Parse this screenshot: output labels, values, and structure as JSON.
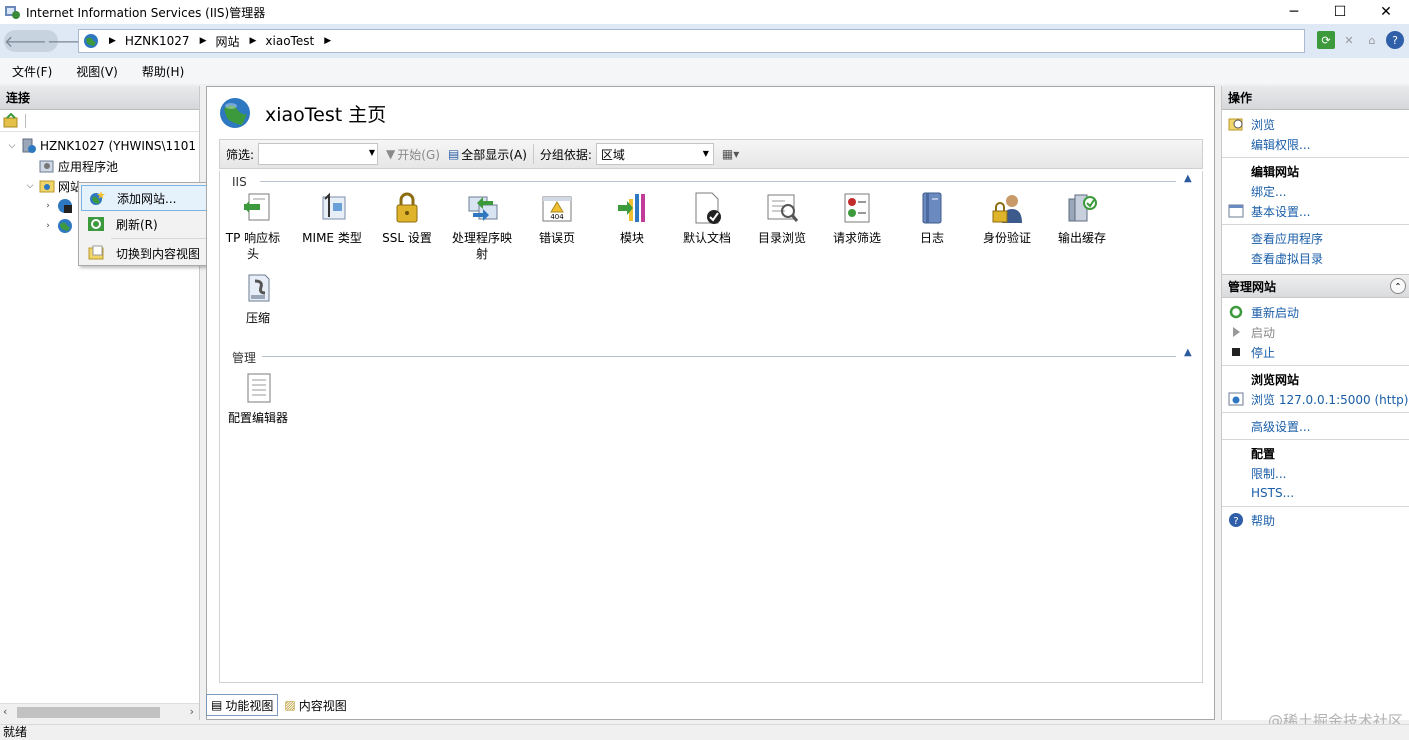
{
  "window": {
    "title": "Internet Information Services (IIS)管理器",
    "controls": [
      "minimize",
      "maximize",
      "close"
    ]
  },
  "address": {
    "crumbs": [
      "HZNK1027",
      "网站",
      "xiaoTest"
    ]
  },
  "menu": [
    "文件(F)",
    "视图(V)",
    "帮助(H)"
  ],
  "left": {
    "header": "连接",
    "tree": [
      {
        "label": "HZNK1027 (YHWINS\\1101",
        "expanded": true
      },
      {
        "label": "应用程序池"
      },
      {
        "label": "网站",
        "expanded": true
      }
    ]
  },
  "context_menu": {
    "items": [
      "添加网站...",
      "刷新(R)",
      "切换到内容视图"
    ],
    "selected": "添加网站..."
  },
  "center": {
    "title": "xiaoTest 主页",
    "filter": {
      "label": "筛选:",
      "go": "开始(G)",
      "show_all": "全部显示(A)",
      "group_label": "分组依据:",
      "group_value": "区域"
    },
    "sections": {
      "iis": "IIS",
      "manage": "管理"
    },
    "iis_features": [
      {
        "label": "TP 响应标\n头",
        "icon": "http-headers-icon"
      },
      {
        "label": "MIME 类型",
        "icon": "mime-icon"
      },
      {
        "label": "SSL 设置",
        "icon": "lock-icon"
      },
      {
        "label": "处理程序映\n射",
        "icon": "handler-mappings-icon"
      },
      {
        "label": "错误页",
        "icon": "error-page-icon"
      },
      {
        "label": "模块",
        "icon": "modules-icon"
      },
      {
        "label": "默认文档",
        "icon": "default-document-icon"
      },
      {
        "label": "目录浏览",
        "icon": "directory-browsing-icon"
      },
      {
        "label": "请求筛选",
        "icon": "request-filtering-icon"
      },
      {
        "label": "日志",
        "icon": "logging-icon"
      },
      {
        "label": "身份验证",
        "icon": "authentication-icon"
      },
      {
        "label": "输出缓存",
        "icon": "output-caching-icon"
      },
      {
        "label": "压缩",
        "icon": "compression-icon"
      }
    ],
    "manage_features": [
      {
        "label": "配置编辑器",
        "icon": "configuration-editor-icon"
      }
    ],
    "tabs": [
      "功能视图",
      "内容视图"
    ],
    "active_tab": "功能视图"
  },
  "actions": {
    "header": "操作",
    "explore": "浏览",
    "edit_permissions": "编辑权限...",
    "edit_site_header": "编辑网站",
    "bindings": "绑定...",
    "basic_settings": "基本设置...",
    "view_apps": "查看应用程序",
    "view_vdirs": "查看虚拟目录",
    "manage_site_header": "管理网站",
    "restart": "重新启动",
    "start": "启动",
    "stop": "停止",
    "browse_site_header": "浏览网站",
    "browse_link": "浏览 127.0.0.1:5000 (http)",
    "advanced_settings": "高级设置...",
    "configure_header": "配置",
    "limits": "限制...",
    "hsts": "HSTS...",
    "help": "帮助"
  },
  "status": "就绪",
  "watermark": "@稀土掘金技术社区",
  "colors": {
    "link": "#1a5ea8",
    "address_bar": "#dfe9f5",
    "selection": "#e5f1fb"
  }
}
